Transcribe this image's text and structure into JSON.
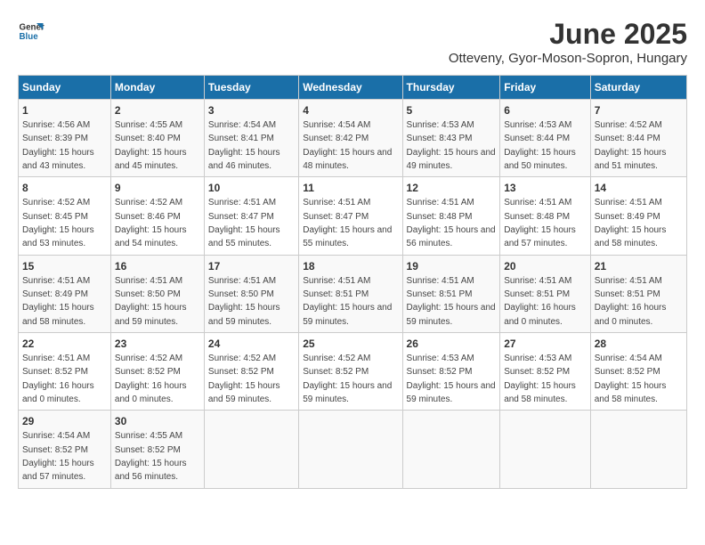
{
  "logo": {
    "line1": "General",
    "line2": "Blue"
  },
  "title": "June 2025",
  "subtitle": "Otteveny, Gyor-Moson-Sopron, Hungary",
  "headers": [
    "Sunday",
    "Monday",
    "Tuesday",
    "Wednesday",
    "Thursday",
    "Friday",
    "Saturday"
  ],
  "weeks": [
    [
      {
        "day": "1",
        "sunrise": "4:56 AM",
        "sunset": "8:39 PM",
        "daylight": "15 hours and 43 minutes."
      },
      {
        "day": "2",
        "sunrise": "4:55 AM",
        "sunset": "8:40 PM",
        "daylight": "15 hours and 45 minutes."
      },
      {
        "day": "3",
        "sunrise": "4:54 AM",
        "sunset": "8:41 PM",
        "daylight": "15 hours and 46 minutes."
      },
      {
        "day": "4",
        "sunrise": "4:54 AM",
        "sunset": "8:42 PM",
        "daylight": "15 hours and 48 minutes."
      },
      {
        "day": "5",
        "sunrise": "4:53 AM",
        "sunset": "8:43 PM",
        "daylight": "15 hours and 49 minutes."
      },
      {
        "day": "6",
        "sunrise": "4:53 AM",
        "sunset": "8:44 PM",
        "daylight": "15 hours and 50 minutes."
      },
      {
        "day": "7",
        "sunrise": "4:52 AM",
        "sunset": "8:44 PM",
        "daylight": "15 hours and 51 minutes."
      }
    ],
    [
      {
        "day": "8",
        "sunrise": "4:52 AM",
        "sunset": "8:45 PM",
        "daylight": "15 hours and 53 minutes."
      },
      {
        "day": "9",
        "sunrise": "4:52 AM",
        "sunset": "8:46 PM",
        "daylight": "15 hours and 54 minutes."
      },
      {
        "day": "10",
        "sunrise": "4:51 AM",
        "sunset": "8:47 PM",
        "daylight": "15 hours and 55 minutes."
      },
      {
        "day": "11",
        "sunrise": "4:51 AM",
        "sunset": "8:47 PM",
        "daylight": "15 hours and 55 minutes."
      },
      {
        "day": "12",
        "sunrise": "4:51 AM",
        "sunset": "8:48 PM",
        "daylight": "15 hours and 56 minutes."
      },
      {
        "day": "13",
        "sunrise": "4:51 AM",
        "sunset": "8:48 PM",
        "daylight": "15 hours and 57 minutes."
      },
      {
        "day": "14",
        "sunrise": "4:51 AM",
        "sunset": "8:49 PM",
        "daylight": "15 hours and 58 minutes."
      }
    ],
    [
      {
        "day": "15",
        "sunrise": "4:51 AM",
        "sunset": "8:49 PM",
        "daylight": "15 hours and 58 minutes."
      },
      {
        "day": "16",
        "sunrise": "4:51 AM",
        "sunset": "8:50 PM",
        "daylight": "15 hours and 59 minutes."
      },
      {
        "day": "17",
        "sunrise": "4:51 AM",
        "sunset": "8:50 PM",
        "daylight": "15 hours and 59 minutes."
      },
      {
        "day": "18",
        "sunrise": "4:51 AM",
        "sunset": "8:51 PM",
        "daylight": "15 hours and 59 minutes."
      },
      {
        "day": "19",
        "sunrise": "4:51 AM",
        "sunset": "8:51 PM",
        "daylight": "15 hours and 59 minutes."
      },
      {
        "day": "20",
        "sunrise": "4:51 AM",
        "sunset": "8:51 PM",
        "daylight": "16 hours and 0 minutes."
      },
      {
        "day": "21",
        "sunrise": "4:51 AM",
        "sunset": "8:51 PM",
        "daylight": "16 hours and 0 minutes."
      }
    ],
    [
      {
        "day": "22",
        "sunrise": "4:51 AM",
        "sunset": "8:52 PM",
        "daylight": "16 hours and 0 minutes."
      },
      {
        "day": "23",
        "sunrise": "4:52 AM",
        "sunset": "8:52 PM",
        "daylight": "16 hours and 0 minutes."
      },
      {
        "day": "24",
        "sunrise": "4:52 AM",
        "sunset": "8:52 PM",
        "daylight": "15 hours and 59 minutes."
      },
      {
        "day": "25",
        "sunrise": "4:52 AM",
        "sunset": "8:52 PM",
        "daylight": "15 hours and 59 minutes."
      },
      {
        "day": "26",
        "sunrise": "4:53 AM",
        "sunset": "8:52 PM",
        "daylight": "15 hours and 59 minutes."
      },
      {
        "day": "27",
        "sunrise": "4:53 AM",
        "sunset": "8:52 PM",
        "daylight": "15 hours and 58 minutes."
      },
      {
        "day": "28",
        "sunrise": "4:54 AM",
        "sunset": "8:52 PM",
        "daylight": "15 hours and 58 minutes."
      }
    ],
    [
      {
        "day": "29",
        "sunrise": "4:54 AM",
        "sunset": "8:52 PM",
        "daylight": "15 hours and 57 minutes."
      },
      {
        "day": "30",
        "sunrise": "4:55 AM",
        "sunset": "8:52 PM",
        "daylight": "15 hours and 56 minutes."
      },
      null,
      null,
      null,
      null,
      null
    ]
  ]
}
